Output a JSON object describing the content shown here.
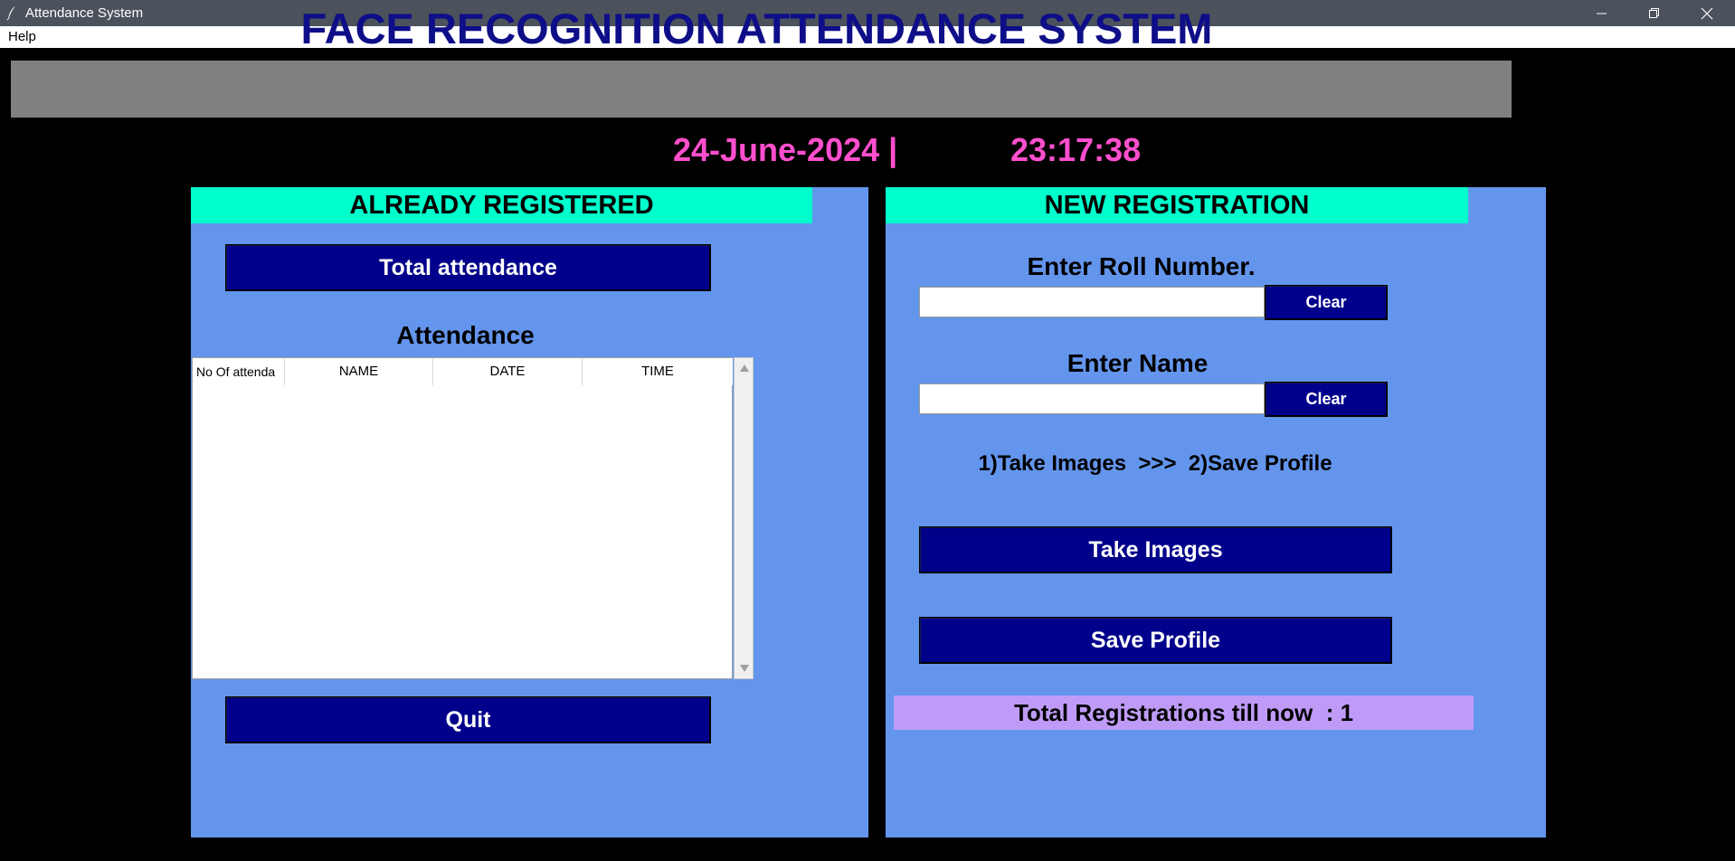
{
  "window": {
    "title": "Attendance System"
  },
  "menu": {
    "items": [
      "Help"
    ]
  },
  "header": {
    "title": "FACE RECOGNITION ATTENDANCE SYSTEM",
    "date": "24-June-2024  |",
    "time": "23:17:38"
  },
  "left_panel": {
    "heading": "ALREADY REGISTERED",
    "total_attendance_button": "Total attendance",
    "attendance_label": "Attendance",
    "table": {
      "columns": [
        "No Of attenda",
        "NAME",
        "DATE",
        "TIME"
      ],
      "rows": []
    },
    "quit_button": "Quit"
  },
  "right_panel": {
    "heading": "NEW REGISTRATION",
    "roll_label": "Enter Roll Number.",
    "roll_value": "",
    "name_label": "Enter Name",
    "name_value": "",
    "clear_label": "Clear",
    "steps_text": "1)Take Images  >>>  2)Save Profile",
    "take_images_button": "Take Images",
    "save_profile_button": "Save Profile",
    "total_registrations": "Total Registrations till now  : 1"
  },
  "colors": {
    "background": "#000000",
    "panel": "#6495ed",
    "heading": "#00ffcc",
    "button": "#00008b",
    "datetime": "#ff4fce",
    "title_text": "#0e0e88",
    "registrations_bg": "#bf9bf7"
  },
  "icons": {
    "app": "feather-icon",
    "minimize": "minimize-icon",
    "restore": "restore-icon",
    "close": "close-icon",
    "scroll_up": "scroll-up-arrow-icon",
    "scroll_down": "scroll-down-arrow-icon"
  }
}
